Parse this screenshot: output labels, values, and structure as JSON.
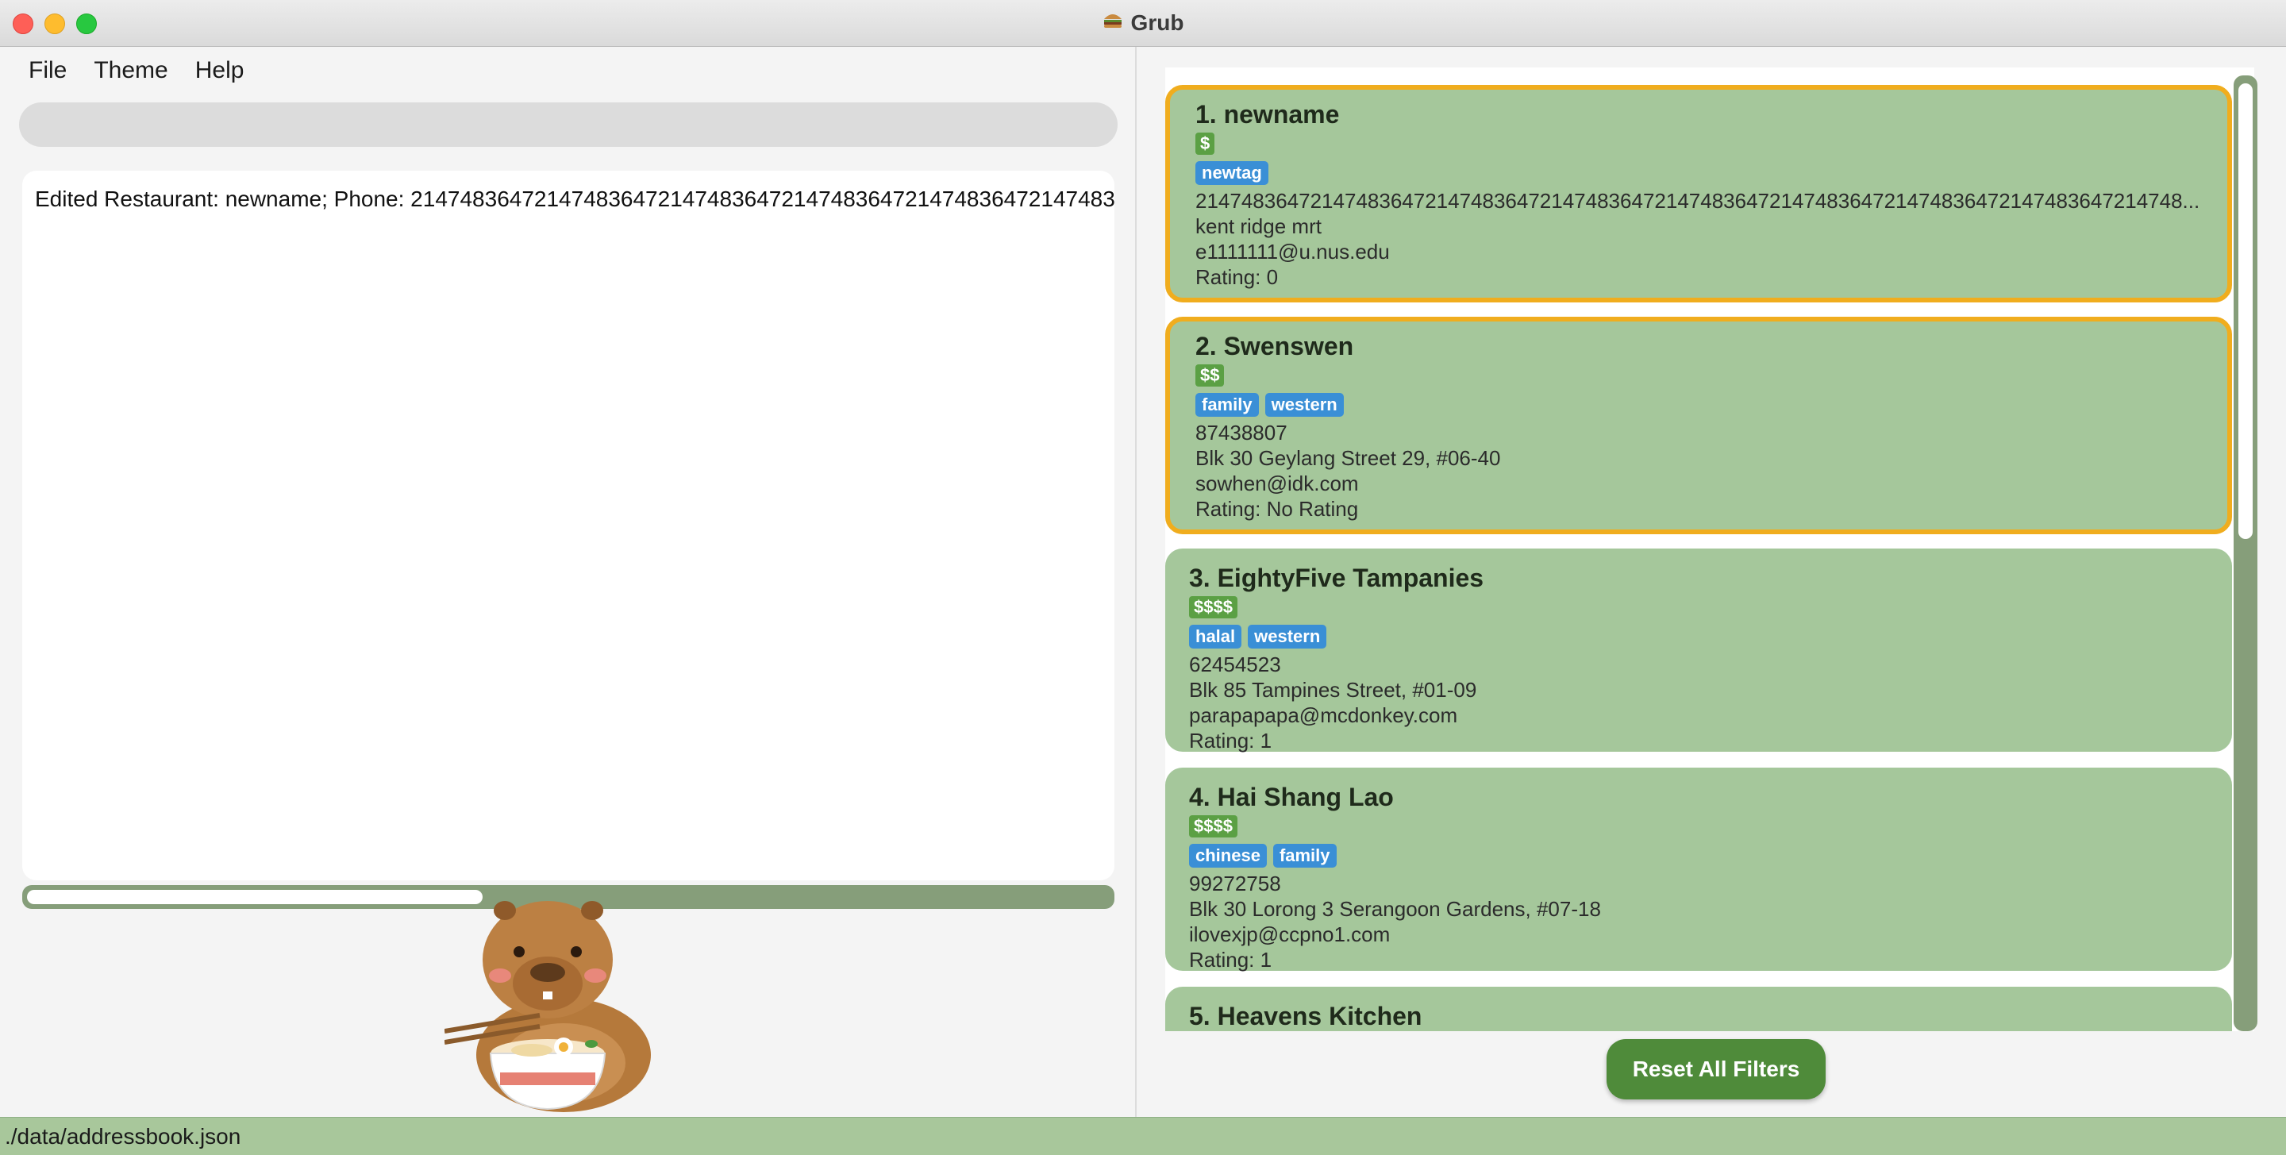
{
  "window": {
    "title": "Grub",
    "icon": "burger-icon"
  },
  "menu": {
    "file": "File",
    "theme": "Theme",
    "help": "Help"
  },
  "command_box": {
    "value": "",
    "placeholder": ""
  },
  "result": {
    "text": "Edited Restaurant: newname; Phone: 214748364721474836472147483647214748364721474836472147483647"
  },
  "restaurants": [
    {
      "name": "1. newname",
      "price": "$",
      "tags": [
        "newtag"
      ],
      "phone": "21474836472147483647214748364721474836472147483647214748364721474836472147483647214748...",
      "address": "kent ridge mrt",
      "email": "e1111111@u.nus.edu",
      "rating": "Rating: 0",
      "selected": true
    },
    {
      "name": "2. Swenswen",
      "price": "$$",
      "tags": [
        "family",
        "western"
      ],
      "phone": "87438807",
      "address": "Blk 30 Geylang Street 29, #06-40",
      "email": "sowhen@idk.com",
      "rating": "Rating: No Rating",
      "selected": true
    },
    {
      "name": "3. EightyFive Tampanies",
      "price": "$$$$",
      "tags": [
        "halal",
        "western"
      ],
      "phone": "62454523",
      "address": "Blk 85 Tampines Street, #01-09",
      "email": "parapapapa@mcdonkey.com",
      "rating": "Rating: 1",
      "selected": false
    },
    {
      "name": "4. Hai Shang Lao",
      "price": "$$$$",
      "tags": [
        "chinese",
        "family"
      ],
      "phone": "99272758",
      "address": "Blk 30 Lorong 3 Serangoon Gardens, #07-18",
      "email": "ilovexjp@ccpno1.com",
      "rating": "Rating: 1",
      "selected": false
    },
    {
      "name": "5. Heavens Kitchen",
      "price": "$$$",
      "tags": [],
      "phone": "",
      "address": "",
      "email": "",
      "rating": "",
      "selected": false
    }
  ],
  "buttons": {
    "reset": "Reset All Filters"
  },
  "status": {
    "path": "./data/addressbook.json"
  },
  "colors": {
    "card_bg": "#a5c79b",
    "selected_border": "#f0ad1e",
    "price_badge": "#5ba044",
    "tag_badge": "#3a8fd6",
    "scrollbar": "#869e7a",
    "reset_button": "#4f8b3a",
    "statusbar": "#a8c79b"
  }
}
